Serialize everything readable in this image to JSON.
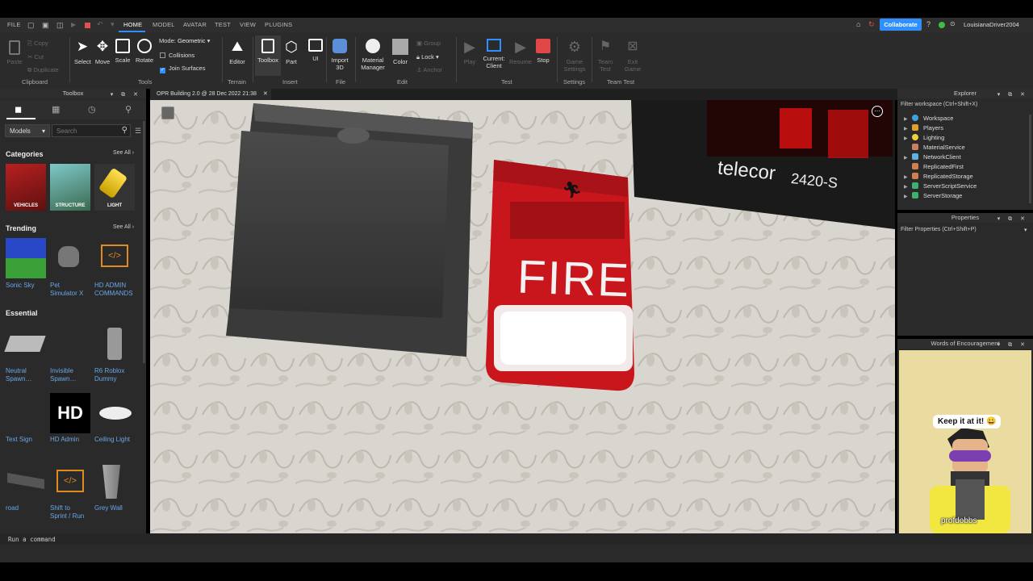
{
  "menubar": {
    "items": [
      "FILE",
      "HOME",
      "MODEL",
      "AVATAR",
      "TEST",
      "VIEW",
      "PLUGINS"
    ],
    "active": "HOME",
    "collaborate": "Collaborate",
    "username": "LouisianaDriver2004"
  },
  "ribbon": {
    "clipboard": {
      "paste": "Paste",
      "copy": "Copy",
      "cut": "Cut",
      "duplicate": "Duplicate",
      "group": "Clipboard"
    },
    "tools": {
      "select": "Select",
      "move": "Move",
      "scale": "Scale",
      "rotate": "Rotate",
      "mode_label": "Mode:",
      "mode_value": "Geometric",
      "collisions": "Collisions",
      "join_surfaces": "Join Surfaces",
      "group": "Tools"
    },
    "terrain": {
      "editor": "Editor",
      "group": "Terrain"
    },
    "insert": {
      "toolbox": "Toolbox",
      "part": "Part",
      "ui": "UI",
      "group": "Insert"
    },
    "file": {
      "import_line1": "Import",
      "import_line2": "3D",
      "group": "File"
    },
    "edit": {
      "material_line1": "Material",
      "material_line2": "Manager",
      "color": "Color",
      "group_label": "Group",
      "lock": "Lock",
      "anchor": "Anchor",
      "group": "Edit"
    },
    "test": {
      "play": "Play",
      "current_line1": "Current:",
      "current_line2": "Client",
      "resume": "Resume",
      "stop": "Stop",
      "group": "Test"
    },
    "settings": {
      "game_line1": "Game",
      "game_line2": "Settings",
      "group": "Settings"
    },
    "teamtest": {
      "team_line1": "Team",
      "team_line2": "Test",
      "exit_line1": "Exit",
      "exit_line2": "Game",
      "group": "Team Test"
    }
  },
  "toolbox": {
    "title": "Toolbox",
    "category_select": "Models",
    "search_placeholder": "Search",
    "categories_title": "Categories",
    "see_all": "See All ›",
    "categories": [
      "VEHICLES",
      "STRUCTURE",
      "LIGHT"
    ],
    "trending_title": "Trending",
    "trending": [
      {
        "line1": "Sonic Sky",
        "line2": ""
      },
      {
        "line1": "Pet",
        "line2": "Simulator X"
      },
      {
        "line1": "HD ADMIN",
        "line2": "COMMANDS"
      }
    ],
    "essential_title": "Essential",
    "essential": [
      {
        "line1": "Neutral",
        "line2": "Spawn…"
      },
      {
        "line1": "Invisible",
        "line2": "Spawn…"
      },
      {
        "line1": "R6 Roblox",
        "line2": "Dummy"
      },
      {
        "line1": "Text Sign",
        "line2": ""
      },
      {
        "line1": "HD Admin",
        "line2": ""
      },
      {
        "line1": "Ceiling Light",
        "line2": ""
      },
      {
        "line1": "road",
        "line2": ""
      },
      {
        "line1": "Shift to",
        "line2": "Sprint / Run"
      },
      {
        "line1": "Grey Wall",
        "line2": ""
      }
    ],
    "hd_logo": "HD"
  },
  "document_tab": "OPR Building 2.0 @ 28 Dec 2022 21:38",
  "viewport": {
    "fire_label": "FIRE",
    "clock_brand": "telecor",
    "clock_model": "2420-S"
  },
  "explorer": {
    "title": "Explorer",
    "filter": "Filter workspace (Ctrl+Shift+X)",
    "items": [
      "Workspace",
      "Players",
      "Lighting",
      "MaterialService",
      "NetworkClient",
      "ReplicatedFirst",
      "ReplicatedStorage",
      "ServerScriptService",
      "ServerStorage"
    ]
  },
  "properties": {
    "title": "Properties",
    "filter": "Filter Properties (Ctrl+Shift+P)"
  },
  "encouragement": {
    "title": "Words of Encouragement",
    "message": "Keep it at it! 😀",
    "username": "profdobbs"
  },
  "command_bar": {
    "placeholder": "Run a command"
  },
  "colors": {
    "accent": "#2f8fff",
    "fire_red": "#c8161c",
    "panel": "#2a2a2a"
  }
}
